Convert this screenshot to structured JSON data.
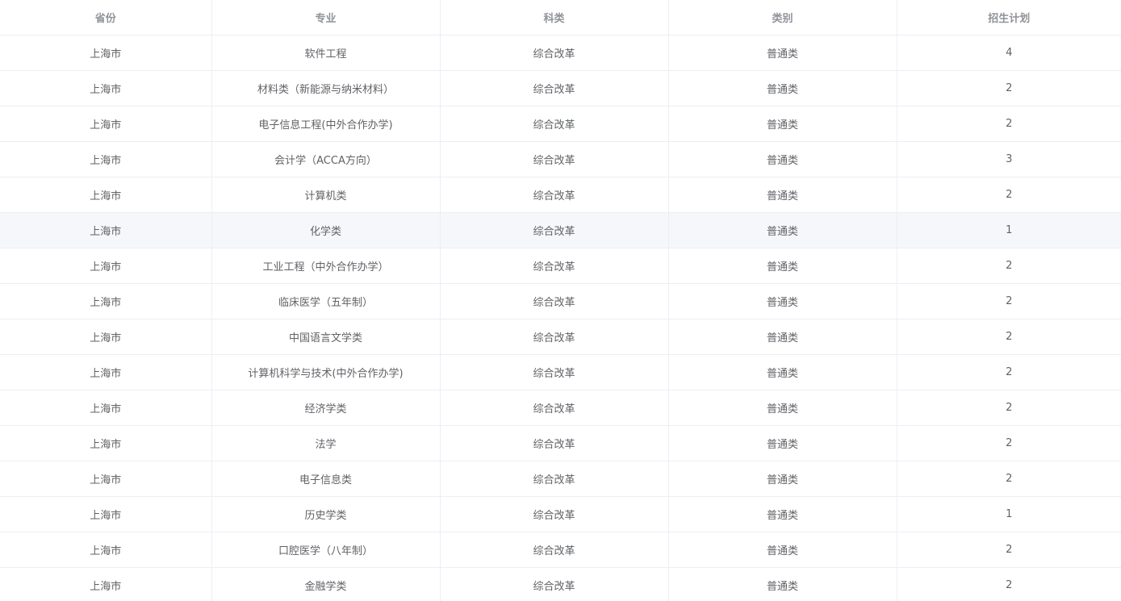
{
  "table": {
    "columns": [
      "省份",
      "专业",
      "科类",
      "类别",
      "招生计划"
    ],
    "hover_row_index": 5,
    "hover_color": "#f5f7fa",
    "rows": [
      [
        "上海市",
        "软件工程",
        "综合改革",
        "普通类",
        "4"
      ],
      [
        "上海市",
        "材料类（新能源与纳米材料）",
        "综合改革",
        "普通类",
        "2"
      ],
      [
        "上海市",
        "电子信息工程(中外合作办学)",
        "综合改革",
        "普通类",
        "2"
      ],
      [
        "上海市",
        "会计学（ACCA方向）",
        "综合改革",
        "普通类",
        "3"
      ],
      [
        "上海市",
        "计算机类",
        "综合改革",
        "普通类",
        "2"
      ],
      [
        "上海市",
        "化学类",
        "综合改革",
        "普通类",
        "1"
      ],
      [
        "上海市",
        "工业工程（中外合作办学）",
        "综合改革",
        "普通类",
        "2"
      ],
      [
        "上海市",
        "临床医学（五年制）",
        "综合改革",
        "普通类",
        "2"
      ],
      [
        "上海市",
        "中国语言文学类",
        "综合改革",
        "普通类",
        "2"
      ],
      [
        "上海市",
        "计算机科学与技术(中外合作办学)",
        "综合改革",
        "普通类",
        "2"
      ],
      [
        "上海市",
        "经济学类",
        "综合改革",
        "普通类",
        "2"
      ],
      [
        "上海市",
        "法学",
        "综合改革",
        "普通类",
        "2"
      ],
      [
        "上海市",
        "电子信息类",
        "综合改革",
        "普通类",
        "2"
      ],
      [
        "上海市",
        "历史学类",
        "综合改革",
        "普通类",
        "1"
      ],
      [
        "上海市",
        "口腔医学（八年制）",
        "综合改革",
        "普通类",
        "2"
      ],
      [
        "上海市",
        "金融学类",
        "综合改革",
        "普通类",
        "2"
      ]
    ]
  }
}
